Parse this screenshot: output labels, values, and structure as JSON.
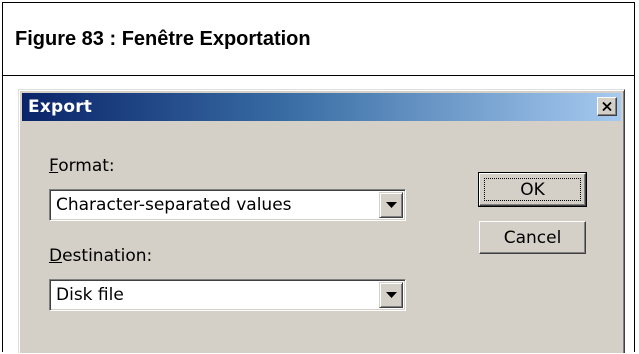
{
  "figure": {
    "caption": "Figure 83 : Fenêtre Exportation"
  },
  "dialog": {
    "title": "Export",
    "close_icon": "close-icon",
    "format": {
      "label_mnemonic": "F",
      "label_rest": "ormat:",
      "value": "Character-separated values"
    },
    "destination": {
      "label_mnemonic": "D",
      "label_rest": "estination:",
      "value": "Disk file"
    },
    "buttons": {
      "ok_label": "OK",
      "cancel_label": "Cancel"
    }
  },
  "colors": {
    "titlebar_start": "#0a246a",
    "titlebar_end": "#a6caf0",
    "dialog_face": "#d4d0c8"
  }
}
